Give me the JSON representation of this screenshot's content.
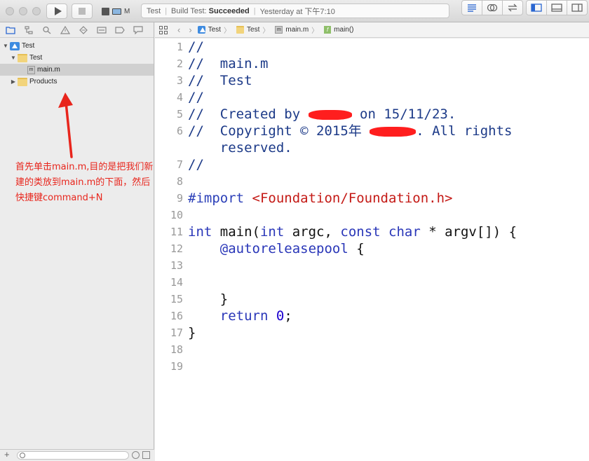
{
  "toolbar": {
    "scheme_label": "M",
    "status_scheme": "Test",
    "status_build_prefix": "Build Test:",
    "status_build_result": "Succeeded",
    "status_time": "Yesterday at 下午7:10"
  },
  "navigator": {
    "tree": [
      {
        "label": "Test",
        "kind": "project",
        "level": 0,
        "expanded": true
      },
      {
        "label": "Test",
        "kind": "folder",
        "level": 1,
        "expanded": true
      },
      {
        "label": "main.m",
        "kind": "file",
        "level": 2,
        "selected": true
      },
      {
        "label": "Products",
        "kind": "folder",
        "level": 1,
        "expanded": false
      }
    ],
    "file_badge": "m"
  },
  "annotation": {
    "text": "首先单击main.m,目的是把我们新建的类放到main.m的下面，然后快捷键command+N",
    "color": "#e8251c"
  },
  "jumpbar": {
    "crumbs": [
      "Test",
      "Test",
      "main.m",
      "main()"
    ],
    "fx_badge": "f"
  },
  "editor": {
    "line_numbers": [
      "1",
      "2",
      "3",
      "4",
      "5",
      "6",
      "7",
      "8",
      "9",
      "10",
      "11",
      "12",
      "13",
      "14",
      "15",
      "16",
      "17",
      "18",
      "19"
    ],
    "l1": "//",
    "l2": "//  main.m",
    "l3": "//  Test",
    "l4": "//",
    "l5a": "//  Created by ",
    "l5b": " on 15/11/23.",
    "l6a": "//  Copyright © 2015年 ",
    "l6b": ". All rights",
    "l6c": "    reserved.",
    "l7": "//",
    "l9a": "#import",
    "l9b": " <Foundation/Foundation.h>",
    "l11_kw1": "int",
    "l11_a": " main(",
    "l11_kw2": "int",
    "l11_b": " argc, ",
    "l11_kw3": "const",
    "l11_c": " ",
    "l11_kw4": "char",
    "l11_d": " * argv[]) {",
    "l12_indent": "    ",
    "l12_at": "@autoreleasepool",
    "l12_b": " {",
    "l15": "    }",
    "l16_indent": "    ",
    "l16_kw": "return",
    "l16_sp": " ",
    "l16_num": "0",
    "l16_end": ";",
    "l17": "}"
  }
}
